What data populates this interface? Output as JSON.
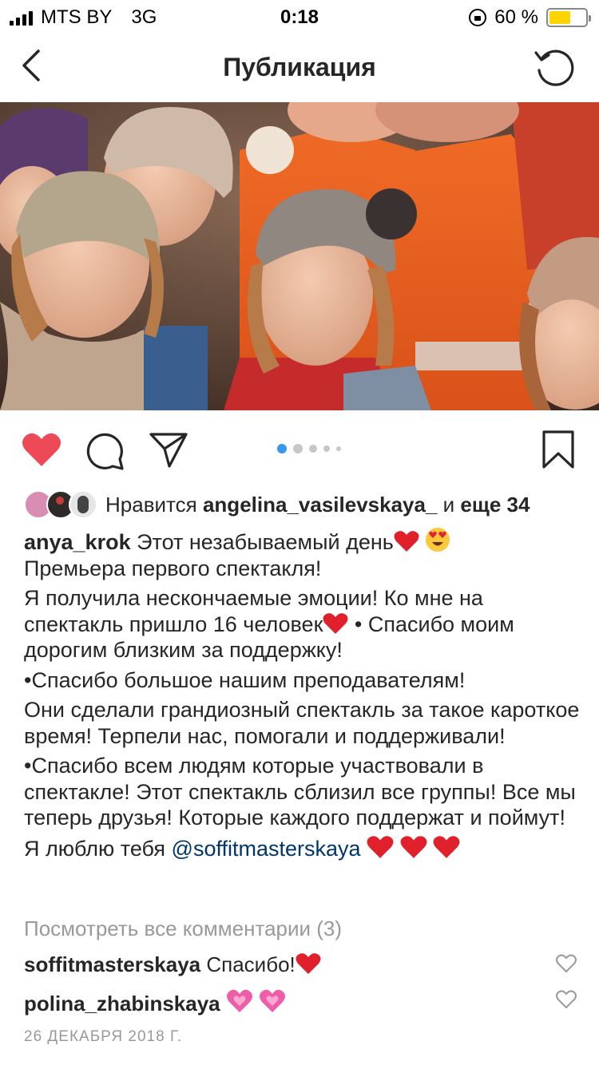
{
  "status_bar": {
    "carrier": "MTS BY",
    "network": "3G",
    "time": "0:18",
    "battery": "60 %",
    "battery_level": 0.6
  },
  "nav": {
    "title": "Публикация",
    "back_icon": "chevron-left-icon",
    "refresh_icon": "refresh-icon"
  },
  "post": {
    "carousel_total": 5,
    "carousel_active": 1,
    "liked": true,
    "likes": {
      "prefix": "Нравится",
      "user": "angelina_vasilevskaya_",
      "conjunction": "и",
      "others": "еще 34"
    },
    "caption": {
      "user": "anya_krok",
      "line1": "Этот незабываемый день",
      "line2": "Премьера первого спектакля!",
      "para2a": "Я получила несконч﻿аемые эмоции! Ко мне на спектакль пришло 16 человек",
      "para2b": " • Спасибо моим дорогим близким за поддержку!",
      "para3": "•Спасибо  большое нашим преподавателям!",
      "para4": "Они сделали грандиозный спектакль за такое кароткое время! Терпели нас, помогали и поддерживали!",
      "para5": "•Спасибо всем людям которые участвовали в спектакле! Этот спектакль сблизил все группы! Все мы теперь друзья! Которые каждого поддержат и поймут!",
      "para6": "Я люблю тебя ",
      "mention": "@soffitmasterskaya"
    },
    "view_comments": "Посмотреть все комментарии (3)",
    "comments": [
      {
        "user": "soffitmasterskaya",
        "text": "Спасибо!"
      },
      {
        "user": "polina_zhabinskaya",
        "text": ""
      }
    ],
    "date": "26 ДЕКАБРЯ 2018 Г."
  },
  "colors": {
    "like_red": "#ed4956",
    "link_blue": "#003569",
    "carousel_active": "#3897f0",
    "battery_yellow": "#fdd400"
  }
}
